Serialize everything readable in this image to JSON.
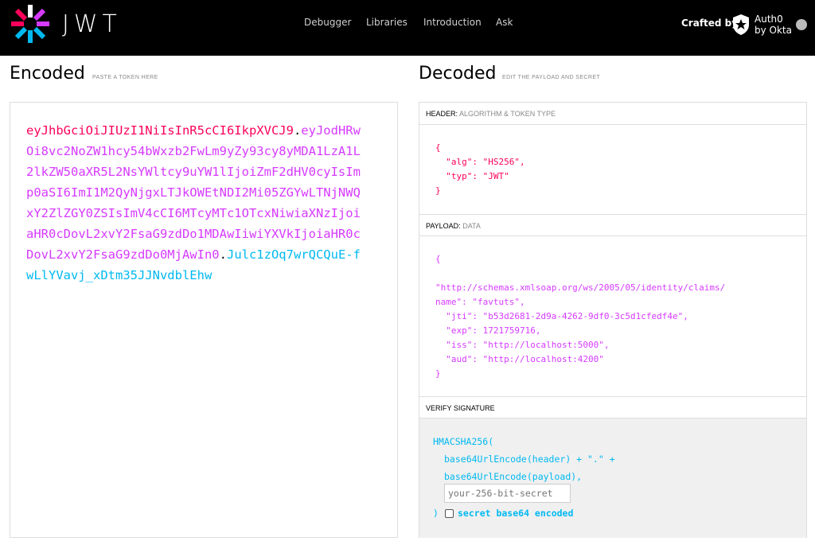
{
  "nav": {
    "brand": "JWT",
    "links": [
      "Debugger",
      "Libraries",
      "Introduction",
      "Ask"
    ],
    "crafted_by": "Crafted by",
    "partner_line1": "Auth0",
    "partner_line2": "by Okta",
    "logo_colors": [
      "#fb015b",
      "#d63aff",
      "#00b9f1",
      "#ffffff"
    ]
  },
  "encoded": {
    "title": "Encoded",
    "subtitle": "PASTE A TOKEN HERE",
    "token_header": "eyJhbGciOiJIUzI1NiIsInR5cCI6IkpXVCJ9",
    "token_payload": "eyJodHRwOi8vc2NoZW1hcy54bWxzb2FwLm9yZy93cy8yMDA1LzA1L2lkZW50aXR5L2NsYWltcy9uYW1lIjoiZmF2dHV0cyIsImp0aSI6ImI1M2QyNjgxLTJkOWEtNDI2Mi05ZGYwLTNjNWQxY2ZlZGY0ZSIsImV4cCI6MTcyMTc1OTcxNiwiaXNzIjoiaHR0cDovL2xvY2FsaG9zdDo1MDAwIiwiYXVkIjoiaHR0cDovL2xvY2FsaG9zdDo0MjAwIn0",
    "token_signature": "Julc1zOq7wrQCQuE-fwLlYVavj_xDtm35JJNvdblEhw",
    "dot": "."
  },
  "decoded": {
    "title": "Decoded",
    "subtitle": "EDIT THE PAYLOAD AND SECRET",
    "header_label": "HEADER:",
    "header_sub": "ALGORITHM & TOKEN TYPE",
    "header_json": "{\n  \"alg\": \"HS256\",\n  \"typ\": \"JWT\"\n}",
    "payload_label": "PAYLOAD:",
    "payload_sub": "DATA",
    "payload_json": "{\n\n\"http://schemas.xmlsoap.org/ws/2005/05/identity/claims/\nname\": \"favtuts\",\n  \"jti\": \"b53d2681-2d9a-4262-9df0-3c5d1cfedf4e\",\n  \"exp\": 1721759716,\n  \"iss\": \"http://localhost:5000\",\n  \"aud\": \"http://localhost:4200\"\n}",
    "verify_label": "VERIFY SIGNATURE",
    "verify_fn": "HMACSHA256(",
    "verify_line1": "base64UrlEncode(header) + \".\" +",
    "verify_line2": "base64UrlEncode(payload),",
    "secret_placeholder": "your-256-bit-secret",
    "close_paren": ")",
    "checkbox_label": "secret base64 encoded"
  }
}
